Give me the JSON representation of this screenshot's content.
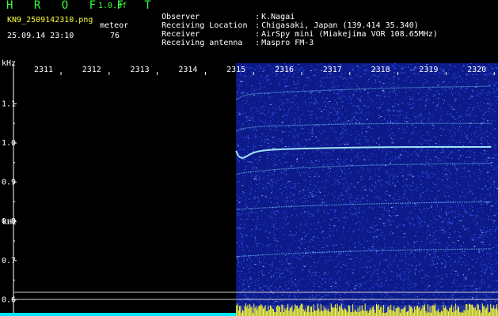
{
  "app": {
    "brand": "H R O F F T",
    "version": "1.0.0f",
    "filename": "KN9_2509142310.png",
    "mode": "meteor",
    "datetime": "25.09.14 23:10",
    "count": "76"
  },
  "info": [
    {
      "label": "Observer",
      "value": "K.Nagai"
    },
    {
      "label": "Receiving Location",
      "value": "Chigasaki, Japan (139.414 35.340)"
    },
    {
      "label": "Receiver",
      "value": "AirSpy mini (Miakejima VOR 108.65MHz)"
    },
    {
      "label": "Receiving antenna",
      "value": "Maspro FM-3"
    }
  ],
  "colors": {
    "background": "#000000",
    "spectrogram": "#0c1a8a",
    "noise": "#3a5cff",
    "echo": "#7fe0ff",
    "text": "#ffffff",
    "accent": "#3cff3c",
    "activity": "#ffff30",
    "baseline": "#00e6ff"
  },
  "chart_data": {
    "type": "heatmap",
    "x_unit": "time (HHMM)",
    "y_unit": "kHz",
    "y_unit_label_top": "kHz",
    "y_unit_label_bottom": "kHz",
    "x_ticks": [
      "2311",
      "2312",
      "2313",
      "2314",
      "2315",
      "2316",
      "2317",
      "2318",
      "2319",
      "2320"
    ],
    "y_ticks": [
      "1.1",
      "1.0",
      "0.9",
      "0.8",
      "0.7",
      "0.6"
    ],
    "ylim": [
      0.58,
      1.18
    ],
    "data_start": "2315",
    "signal_traces": [
      {
        "points": [
          [
            2315.0,
            1.11
          ],
          [
            2315.2,
            1.125
          ],
          [
            2316.0,
            1.13
          ],
          [
            2318.0,
            1.14
          ],
          [
            2320.3,
            1.145
          ]
        ]
      },
      {
        "points": [
          [
            2315.0,
            1.03
          ],
          [
            2315.2,
            1.04
          ],
          [
            2316.0,
            1.045
          ],
          [
            2318.0,
            1.05
          ],
          [
            2320.3,
            1.05
          ]
        ]
      },
      {
        "points": [
          [
            2315.0,
            0.98
          ],
          [
            2315.05,
            0.965
          ],
          [
            2315.15,
            0.96
          ],
          [
            2315.4,
            0.98
          ],
          [
            2316.0,
            0.985
          ],
          [
            2318.0,
            0.99
          ],
          [
            2320.3,
            0.99
          ]
        ]
      },
      {
        "points": [
          [
            2315.0,
            0.92
          ],
          [
            2315.2,
            0.925
          ],
          [
            2316.0,
            0.935
          ],
          [
            2318.0,
            0.945
          ],
          [
            2320.3,
            0.948
          ]
        ]
      },
      {
        "points": [
          [
            2315.0,
            0.83
          ],
          [
            2316.0,
            0.838
          ],
          [
            2318.0,
            0.846
          ],
          [
            2320.3,
            0.85
          ]
        ]
      },
      {
        "points": [
          [
            2315.0,
            0.71
          ],
          [
            2316.0,
            0.718
          ],
          [
            2318.0,
            0.726
          ],
          [
            2320.3,
            0.73
          ]
        ]
      }
    ]
  }
}
